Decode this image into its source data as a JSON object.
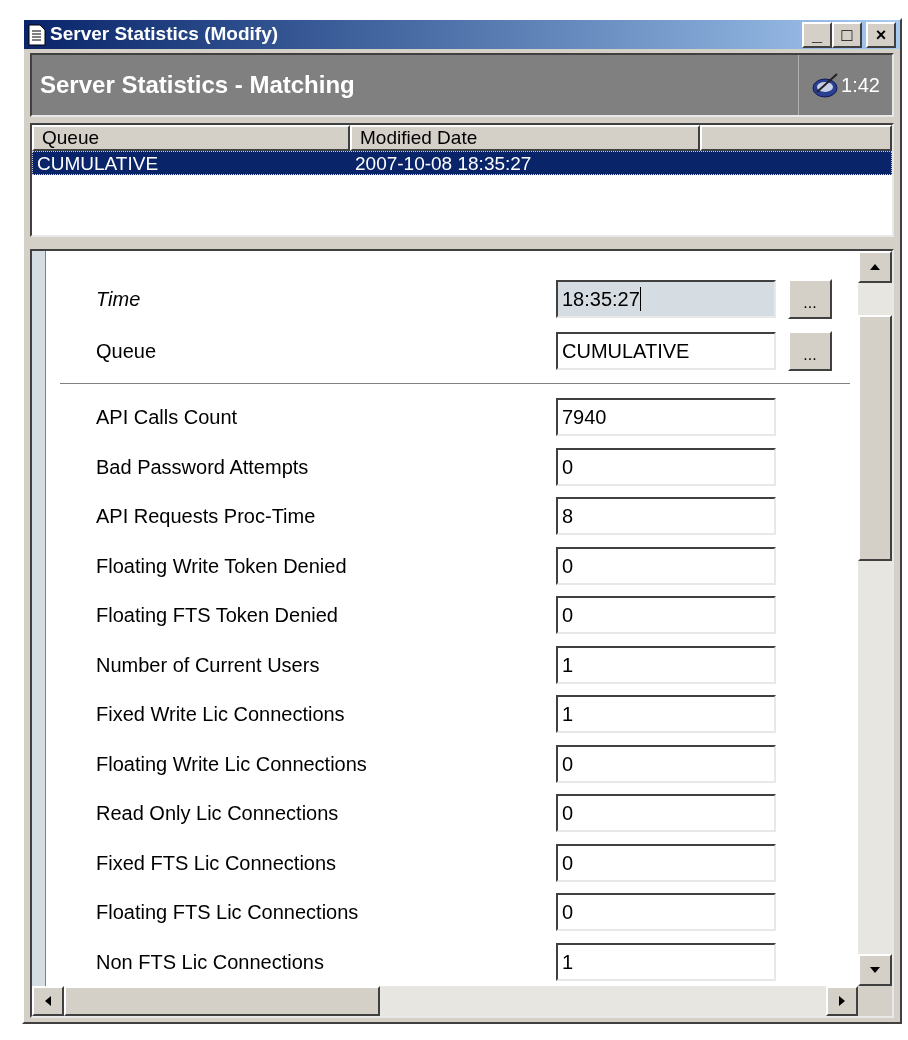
{
  "window": {
    "title": "Server Statistics (Modify)",
    "controls": [
      "_",
      "□",
      "×"
    ]
  },
  "header": {
    "title": "Server Statistics - Matching",
    "time": "1:42"
  },
  "list": {
    "columns": [
      "Queue",
      "Modified Date"
    ],
    "rows": [
      {
        "cells": [
          "CUMULATIVE",
          "2007-10-08 18:35:27"
        ],
        "selected": true
      }
    ]
  },
  "key_fields": [
    {
      "label": "Time",
      "value": "18:35:27",
      "italic": true,
      "focused": true,
      "button": "..."
    },
    {
      "label": "Queue",
      "value": "CUMULATIVE",
      "italic": false,
      "focused": false,
      "button": "..."
    }
  ],
  "fields": [
    {
      "label": "API Calls Count",
      "value": "7940"
    },
    {
      "label": "Bad Password Attempts",
      "value": "0"
    },
    {
      "label": "API Requests Proc-Time",
      "value": "8"
    },
    {
      "label": "Floating Write Token Denied",
      "value": "0"
    },
    {
      "label": "Floating FTS Token Denied",
      "value": "0"
    },
    {
      "label": "Number of Current Users",
      "value": "1"
    },
    {
      "label": "Fixed Write Lic Connections",
      "value": "1"
    },
    {
      "label": "Floating Write Lic Connections",
      "value": "0"
    },
    {
      "label": "Read Only Lic Connections",
      "value": "0"
    },
    {
      "label": "Fixed FTS Lic Connections",
      "value": "0"
    },
    {
      "label": "Floating FTS Lic Connections",
      "value": "0"
    },
    {
      "label": "Non FTS Lic Connections",
      "value": "1"
    }
  ]
}
